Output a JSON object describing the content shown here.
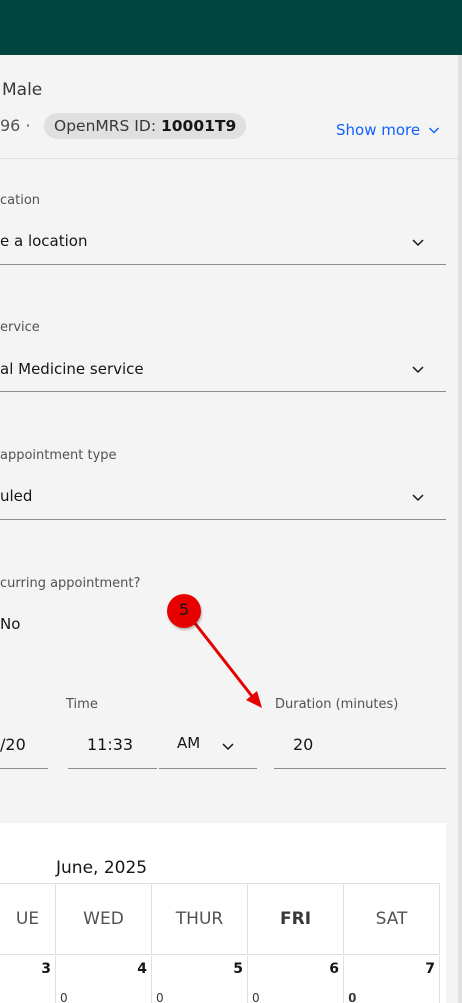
{
  "patient": {
    "gender": "Male",
    "dob_fragment": "96 ·",
    "id_label": "OpenMRS ID:",
    "id_value": "10001T9",
    "show_more": "Show more"
  },
  "form": {
    "location": {
      "label": "cation",
      "value": "e a location"
    },
    "service": {
      "label": "ervice",
      "value": "al Medicine service"
    },
    "appointment_type": {
      "label": "appointment type",
      "value": "uled"
    },
    "recurring": {
      "label": "curring appointment?",
      "value": "No"
    },
    "date_fragment": "/20",
    "time": {
      "label": "Time",
      "value": "11:33",
      "period": "AM"
    },
    "duration": {
      "label": "Duration (minutes)",
      "value": "20"
    }
  },
  "calendar": {
    "month": "June, 2025",
    "headers": [
      "UE",
      "WED",
      "THUR",
      "FRI",
      "SAT"
    ],
    "days": [
      {
        "num": "3",
        "count": "0"
      },
      {
        "num": "4",
        "count": "0"
      },
      {
        "num": "5",
        "count": "0"
      },
      {
        "num": "6",
        "count": "0"
      },
      {
        "num": "7",
        "count": "0"
      }
    ]
  },
  "annotation": {
    "step": "5"
  },
  "colors": {
    "header": "#00453f",
    "link": "#0f62fe",
    "marker": "#e60000"
  }
}
